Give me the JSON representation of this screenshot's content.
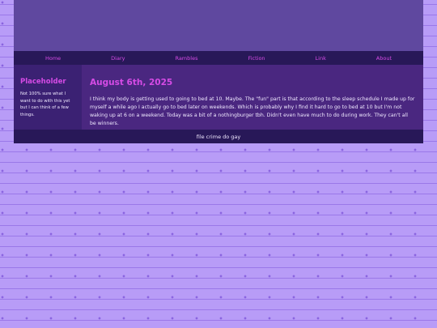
{
  "nav": {
    "items": [
      "Home",
      "Diary",
      "Rambles",
      "Fiction",
      "Link",
      "About"
    ]
  },
  "sidebar": {
    "title": "Placeholder",
    "text": "Not 100% sure what I want to do with this yet but I can think of a few things."
  },
  "post": {
    "title": "August 6th, 2025",
    "body": "I think my body is getting used to going to bed at 10. Maybe. The \"fun\" part is that according to the sleep schedule I made up for myself a while ago I actually go to bed later on weekends. Which is probably why I find it hard to go to bed at 10 but I'm not waking up at 6 on a weekend. Today was a bit of a nothingburger tbh. Didn't even have much to do during work. They can't all be winners."
  },
  "footer": {
    "text": "file crime do gay"
  },
  "colors": {
    "accent": "#d64be6",
    "nav_bg": "#281858",
    "header_bg": "#5f489f",
    "sidebar_bg": "#3b2173",
    "main_bg": "#4a2780",
    "page_bg": "#b89cf7"
  }
}
